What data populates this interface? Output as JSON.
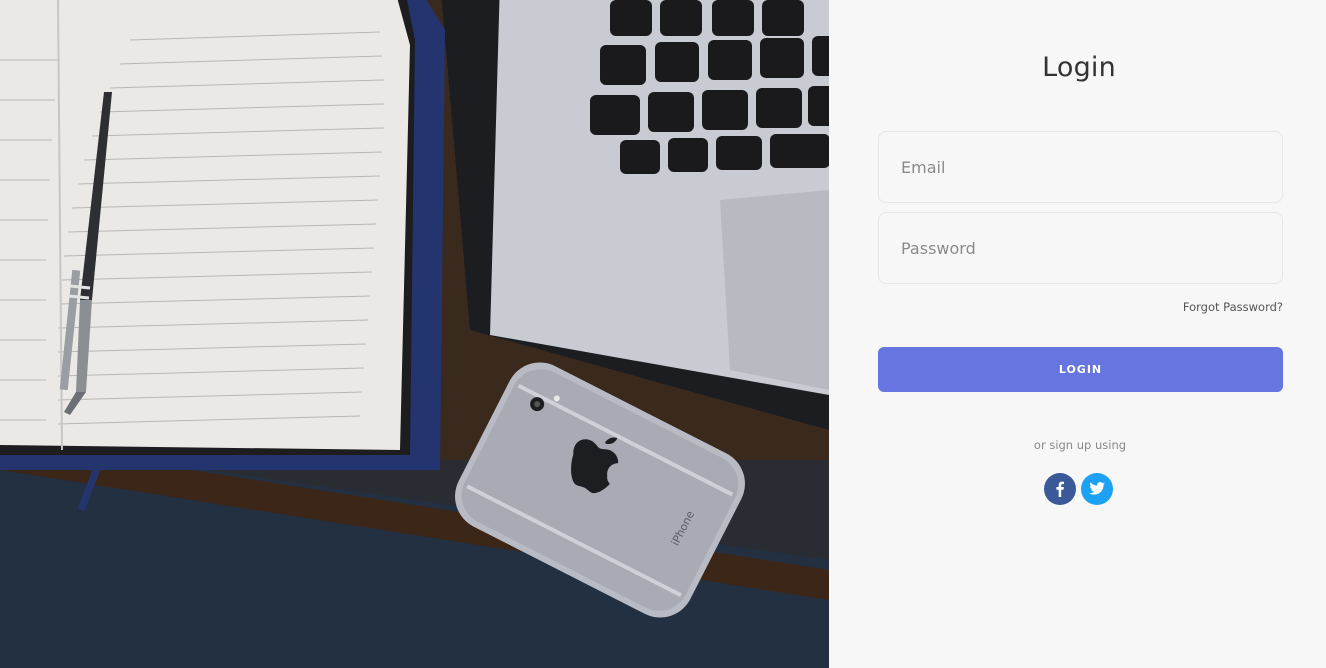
{
  "login": {
    "title": "Login",
    "email_placeholder": "Email",
    "password_placeholder": "Password",
    "forgot_label": "Forgot Password?",
    "login_label": "LOGIN",
    "signup_text": "or sign up using"
  },
  "social": [
    {
      "icon": "facebook-icon",
      "color": "#3b5998"
    },
    {
      "icon": "twitter-icon",
      "color": "#1da1f2"
    }
  ],
  "colors": {
    "accent": "#6675df",
    "panel_bg": "#f7f7f7"
  },
  "hero": {
    "phone_text": "iPhone"
  }
}
